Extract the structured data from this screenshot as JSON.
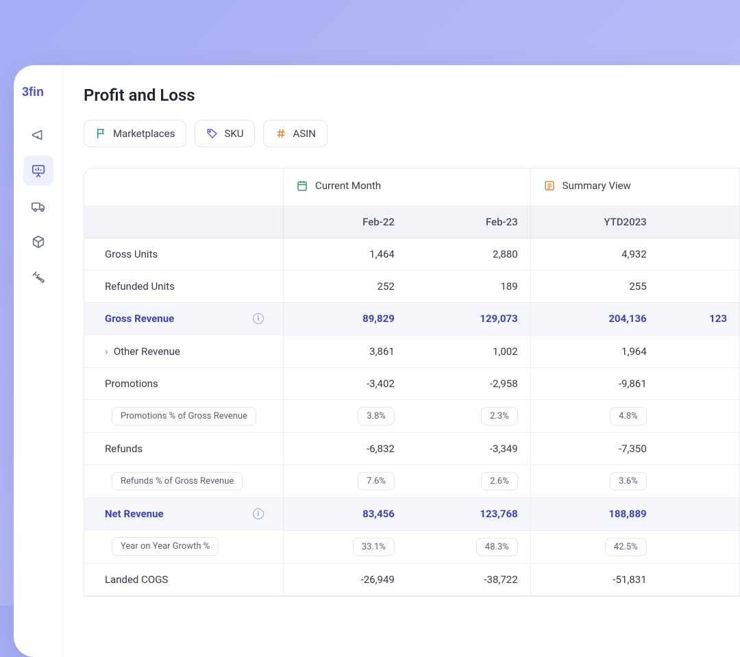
{
  "brand": "3fin",
  "page_title": "Profit and Loss",
  "filters": {
    "marketplaces": "Marketplaces",
    "sku": "SKU",
    "asin": "ASIN"
  },
  "table": {
    "group_headers": {
      "current_month": "Current Month",
      "summary_view": "Summary View"
    },
    "columns": [
      "",
      "Feb-22",
      "Feb-23",
      "YTD2023",
      ""
    ],
    "rows": [
      {
        "type": "data",
        "label": "Gross Units",
        "values": [
          "1,464",
          "2,880",
          "4,932",
          ""
        ]
      },
      {
        "type": "data",
        "label": "Refunded Units",
        "values": [
          "252",
          "189",
          "255",
          ""
        ]
      },
      {
        "type": "bold",
        "label": "Gross Revenue",
        "info": true,
        "values": [
          "89,829",
          "129,073",
          "204,136",
          "123"
        ]
      },
      {
        "type": "expand",
        "label": "Other Revenue",
        "values": [
          "3,861",
          "1,002",
          "1,964",
          ""
        ]
      },
      {
        "type": "data",
        "label": "Promotions",
        "values": [
          "-3,402",
          "-2,958",
          "-9,861",
          ""
        ]
      },
      {
        "type": "badge",
        "label": "Promotions % of Gross Revenue",
        "values": [
          "3.8%",
          "2.3%",
          "4.8%",
          ""
        ]
      },
      {
        "type": "data",
        "label": "Refunds",
        "values": [
          "-6,832",
          "-3,349",
          "-7,350",
          ""
        ]
      },
      {
        "type": "badge",
        "label": "Refunds % of Gross Revenue",
        "values": [
          "7.6%",
          "2.6%",
          "3.6%",
          ""
        ]
      },
      {
        "type": "bold",
        "label": "Net Revenue",
        "info": true,
        "values": [
          "83,456",
          "123,768",
          "188,889",
          ""
        ]
      },
      {
        "type": "badge",
        "label": "Year on Year Growth %",
        "values": [
          "33.1%",
          "48.3%",
          "42.5%",
          ""
        ]
      },
      {
        "type": "data",
        "label": "Landed COGS",
        "values": [
          "-26,949",
          "-38,722",
          "-51,831",
          ""
        ]
      }
    ]
  }
}
